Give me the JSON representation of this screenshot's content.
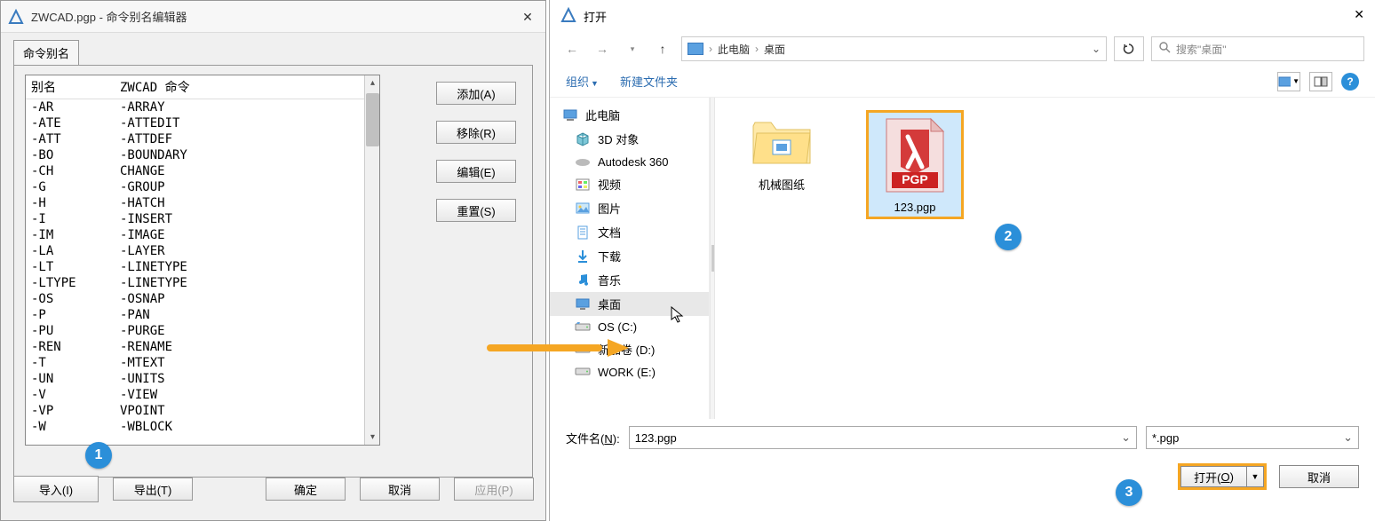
{
  "left": {
    "title": "ZWCAD.pgp - 命令别名编辑器",
    "tab": "命令别名",
    "header_alias": "别名",
    "header_cmd": "ZWCAD 命令",
    "rows": [
      {
        "a": "-AR",
        "c": "-ARRAY"
      },
      {
        "a": "-ATE",
        "c": "-ATTEDIT"
      },
      {
        "a": "-ATT",
        "c": "-ATTDEF"
      },
      {
        "a": "-BO",
        "c": "-BOUNDARY"
      },
      {
        "a": "-CH",
        "c": "CHANGE"
      },
      {
        "a": "-G",
        "c": "-GROUP"
      },
      {
        "a": "-H",
        "c": "-HATCH"
      },
      {
        "a": "-I",
        "c": "-INSERT"
      },
      {
        "a": "-IM",
        "c": "-IMAGE"
      },
      {
        "a": "-LA",
        "c": "-LAYER"
      },
      {
        "a": "-LT",
        "c": "-LINETYPE"
      },
      {
        "a": "-LTYPE",
        "c": "-LINETYPE"
      },
      {
        "a": "-OS",
        "c": "-OSNAP"
      },
      {
        "a": "-P",
        "c": "-PAN"
      },
      {
        "a": "-PU",
        "c": "-PURGE"
      },
      {
        "a": "-REN",
        "c": "-RENAME"
      },
      {
        "a": "-T",
        "c": "-MTEXT"
      },
      {
        "a": "-UN",
        "c": "-UNITS"
      },
      {
        "a": "-V",
        "c": "-VIEW"
      },
      {
        "a": "-VP",
        "c": "VPOINT"
      },
      {
        "a": "-W",
        "c": "-WBLOCK"
      }
    ],
    "btn_add": "添加(A)",
    "btn_remove": "移除(R)",
    "btn_edit": "编辑(E)",
    "btn_reset": "重置(S)",
    "btn_import": "导入(I)",
    "btn_export": "导出(T)",
    "btn_ok": "确定",
    "btn_cancel": "取消",
    "btn_apply": "应用(P)"
  },
  "right": {
    "title": "打开",
    "crumb1": "此电脑",
    "crumb2": "桌面",
    "search_placeholder": "搜索\"桌面\"",
    "organize": "组织",
    "new_folder": "新建文件夹",
    "nav": {
      "pc": "此电脑",
      "obj3d": "3D 对象",
      "autodesk": "Autodesk 360",
      "videos": "视频",
      "pictures": "图片",
      "documents": "文档",
      "downloads": "下载",
      "music": "音乐",
      "desktop": "桌面",
      "osc": "OS (C:)",
      "newvol": "新加卷 (D:)",
      "work": "WORK (E:)"
    },
    "folder_item": "机械图纸",
    "pgp_item": "123.pgp",
    "pgp_badge": "PGP",
    "filename_label_pre": "文件名(",
    "filename_label_u": "N",
    "filename_label_post": "):",
    "filename_value": "123.pgp",
    "filter": "*.pgp",
    "open_btn_pre": "打开(",
    "open_btn_u": "O",
    "open_btn_post": ")",
    "cancel_btn": "取消"
  },
  "badges": {
    "b1": "1",
    "b2": "2",
    "b3": "3"
  }
}
